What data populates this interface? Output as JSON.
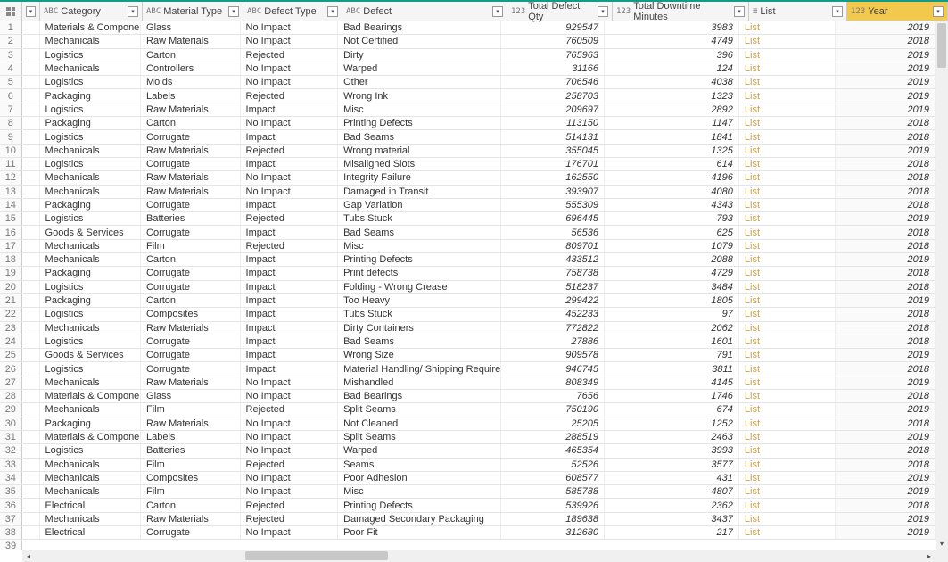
{
  "columns": [
    {
      "key": "category",
      "label": "Category",
      "typeIcon": "ABC",
      "class": "c-cat"
    },
    {
      "key": "material",
      "label": "Material Type",
      "typeIcon": "ABC",
      "class": "c-mat"
    },
    {
      "key": "dtype",
      "label": "Defect Type",
      "typeIcon": "ABC",
      "class": "c-dtype"
    },
    {
      "key": "defect",
      "label": "Defect",
      "typeIcon": "ABC",
      "class": "c-def"
    },
    {
      "key": "qty",
      "label": "Total Defect Qty",
      "typeIcon": "123",
      "class": "c-qty",
      "numeric": true
    },
    {
      "key": "downtime",
      "label": "Total Downtime Minutes",
      "typeIcon": "123",
      "class": "c-dt",
      "numeric": true
    },
    {
      "key": "list",
      "label": "List",
      "typeIcon": "≣",
      "class": "c-list",
      "listcol": true
    },
    {
      "key": "year",
      "label": "Year",
      "typeIcon": "123",
      "class": "c-year",
      "numeric": true,
      "selected": true,
      "yearcol": true
    }
  ],
  "rows": [
    {
      "category": "Materials & Components",
      "material": "Glass",
      "dtype": "No Impact",
      "defect": "Bad Bearings",
      "qty": "929547",
      "downtime": "3983",
      "list": "List",
      "year": "2019"
    },
    {
      "category": "Mechanicals",
      "material": "Raw Materials",
      "dtype": "No Impact",
      "defect": "Not Certified",
      "qty": "760509",
      "downtime": "4749",
      "list": "List",
      "year": "2018"
    },
    {
      "category": "Logistics",
      "material": "Carton",
      "dtype": "Rejected",
      "defect": "Dirty",
      "qty": "765963",
      "downtime": "396",
      "list": "List",
      "year": "2019"
    },
    {
      "category": "Mechanicals",
      "material": "Controllers",
      "dtype": "No Impact",
      "defect": "Warped",
      "qty": "31166",
      "downtime": "124",
      "list": "List",
      "year": "2019"
    },
    {
      "category": "Logistics",
      "material": "Molds",
      "dtype": "No Impact",
      "defect": "Other",
      "qty": "706546",
      "downtime": "4038",
      "list": "List",
      "year": "2019"
    },
    {
      "category": "Packaging",
      "material": "Labels",
      "dtype": "Rejected",
      "defect": "Wrong Ink",
      "qty": "258703",
      "downtime": "1323",
      "list": "List",
      "year": "2019"
    },
    {
      "category": "Logistics",
      "material": "Raw Materials",
      "dtype": "Impact",
      "defect": "Misc",
      "qty": "209697",
      "downtime": "2892",
      "list": "List",
      "year": "2019"
    },
    {
      "category": "Packaging",
      "material": "Carton",
      "dtype": "No Impact",
      "defect": "Printing Defects",
      "qty": "113150",
      "downtime": "1147",
      "list": "List",
      "year": "2018"
    },
    {
      "category": "Logistics",
      "material": "Corrugate",
      "dtype": "Impact",
      "defect": "Bad Seams",
      "qty": "514131",
      "downtime": "1841",
      "list": "List",
      "year": "2018"
    },
    {
      "category": "Mechanicals",
      "material": "Raw Materials",
      "dtype": "Rejected",
      "defect": "Wrong material",
      "qty": "355045",
      "downtime": "1325",
      "list": "List",
      "year": "2019"
    },
    {
      "category": "Logistics",
      "material": "Corrugate",
      "dtype": "Impact",
      "defect": "Misaligned Slots",
      "qty": "176701",
      "downtime": "614",
      "list": "List",
      "year": "2018"
    },
    {
      "category": "Mechanicals",
      "material": "Raw Materials",
      "dtype": "No Impact",
      "defect": "Integrity Failure",
      "qty": "162550",
      "downtime": "4196",
      "list": "List",
      "year": "2018"
    },
    {
      "category": "Mechanicals",
      "material": "Raw Materials",
      "dtype": "No Impact",
      "defect": "Damaged in Transit",
      "qty": "393907",
      "downtime": "4080",
      "list": "List",
      "year": "2018"
    },
    {
      "category": "Packaging",
      "material": "Corrugate",
      "dtype": "Impact",
      "defect": "Gap Variation",
      "qty": "555309",
      "downtime": "4343",
      "list": "List",
      "year": "2018"
    },
    {
      "category": "Logistics",
      "material": "Batteries",
      "dtype": "Rejected",
      "defect": "Tubs Stuck",
      "qty": "696445",
      "downtime": "793",
      "list": "List",
      "year": "2019"
    },
    {
      "category": "Goods & Services",
      "material": "Corrugate",
      "dtype": "Impact",
      "defect": "Bad Seams",
      "qty": "56536",
      "downtime": "625",
      "list": "List",
      "year": "2018"
    },
    {
      "category": "Mechanicals",
      "material": "Film",
      "dtype": "Rejected",
      "defect": "Misc",
      "qty": "809701",
      "downtime": "1079",
      "list": "List",
      "year": "2018"
    },
    {
      "category": "Mechanicals",
      "material": "Carton",
      "dtype": "Impact",
      "defect": "Printing Defects",
      "qty": "433512",
      "downtime": "2088",
      "list": "List",
      "year": "2019"
    },
    {
      "category": "Packaging",
      "material": "Corrugate",
      "dtype": "Impact",
      "defect": "Print defects",
      "qty": "758738",
      "downtime": "4729",
      "list": "List",
      "year": "2018"
    },
    {
      "category": "Logistics",
      "material": "Corrugate",
      "dtype": "Impact",
      "defect": "Folding - Wrong Crease",
      "qty": "518237",
      "downtime": "3484",
      "list": "List",
      "year": "2018"
    },
    {
      "category": "Packaging",
      "material": "Carton",
      "dtype": "Impact",
      "defect": "Too Heavy",
      "qty": "299422",
      "downtime": "1805",
      "list": "List",
      "year": "2019"
    },
    {
      "category": "Logistics",
      "material": "Composites",
      "dtype": "Impact",
      "defect": "Tubs Stuck",
      "qty": "452233",
      "downtime": "97",
      "list": "List",
      "year": "2018"
    },
    {
      "category": "Mechanicals",
      "material": "Raw Materials",
      "dtype": "Impact",
      "defect": "Dirty Containers",
      "qty": "772822",
      "downtime": "2062",
      "list": "List",
      "year": "2018"
    },
    {
      "category": "Logistics",
      "material": "Corrugate",
      "dtype": "Impact",
      "defect": "Bad Seams",
      "qty": "27886",
      "downtime": "1601",
      "list": "List",
      "year": "2018"
    },
    {
      "category": "Goods & Services",
      "material": "Corrugate",
      "dtype": "Impact",
      "defect": "Wrong  Size",
      "qty": "909578",
      "downtime": "791",
      "list": "List",
      "year": "2019"
    },
    {
      "category": "Logistics",
      "material": "Corrugate",
      "dtype": "Impact",
      "defect": "Material Handling/ Shipping Requirements Error",
      "qty": "946745",
      "downtime": "3811",
      "list": "List",
      "year": "2018"
    },
    {
      "category": "Mechanicals",
      "material": "Raw Materials",
      "dtype": "No Impact",
      "defect": "Mishandled",
      "qty": "808349",
      "downtime": "4145",
      "list": "List",
      "year": "2019"
    },
    {
      "category": "Materials & Components",
      "material": "Glass",
      "dtype": "No Impact",
      "defect": "Bad Bearings",
      "qty": "7656",
      "downtime": "1746",
      "list": "List",
      "year": "2018"
    },
    {
      "category": "Mechanicals",
      "material": "Film",
      "dtype": "Rejected",
      "defect": "Split Seams",
      "qty": "750190",
      "downtime": "674",
      "list": "List",
      "year": "2019"
    },
    {
      "category": "Packaging",
      "material": "Raw Materials",
      "dtype": "No Impact",
      "defect": "Not Cleaned",
      "qty": "25205",
      "downtime": "1252",
      "list": "List",
      "year": "2018"
    },
    {
      "category": "Materials & Components",
      "material": "Labels",
      "dtype": "No Impact",
      "defect": "Split Seams",
      "qty": "288519",
      "downtime": "2463",
      "list": "List",
      "year": "2019"
    },
    {
      "category": "Logistics",
      "material": "Batteries",
      "dtype": "No Impact",
      "defect": "Warped",
      "qty": "465354",
      "downtime": "3993",
      "list": "List",
      "year": "2018"
    },
    {
      "category": "Mechanicals",
      "material": "Film",
      "dtype": "Rejected",
      "defect": "Seams",
      "qty": "52526",
      "downtime": "3577",
      "list": "List",
      "year": "2018"
    },
    {
      "category": "Mechanicals",
      "material": "Composites",
      "dtype": "No Impact",
      "defect": "Poor  Adhesion",
      "qty": "608577",
      "downtime": "431",
      "list": "List",
      "year": "2019"
    },
    {
      "category": "Mechanicals",
      "material": "Film",
      "dtype": "No Impact",
      "defect": "Misc",
      "qty": "585788",
      "downtime": "4807",
      "list": "List",
      "year": "2019"
    },
    {
      "category": "Electrical",
      "material": "Carton",
      "dtype": "Rejected",
      "defect": "Printing Defects",
      "qty": "539926",
      "downtime": "2362",
      "list": "List",
      "year": "2018"
    },
    {
      "category": "Mechanicals",
      "material": "Raw Materials",
      "dtype": "Rejected",
      "defect": "Damaged Secondary Packaging",
      "qty": "189638",
      "downtime": "3437",
      "list": "List",
      "year": "2019"
    },
    {
      "category": "Electrical",
      "material": "Corrugate",
      "dtype": "No Impact",
      "defect": "Poor Fit",
      "qty": "312680",
      "downtime": "217",
      "list": "List",
      "year": "2019"
    }
  ],
  "extraRow": 39
}
